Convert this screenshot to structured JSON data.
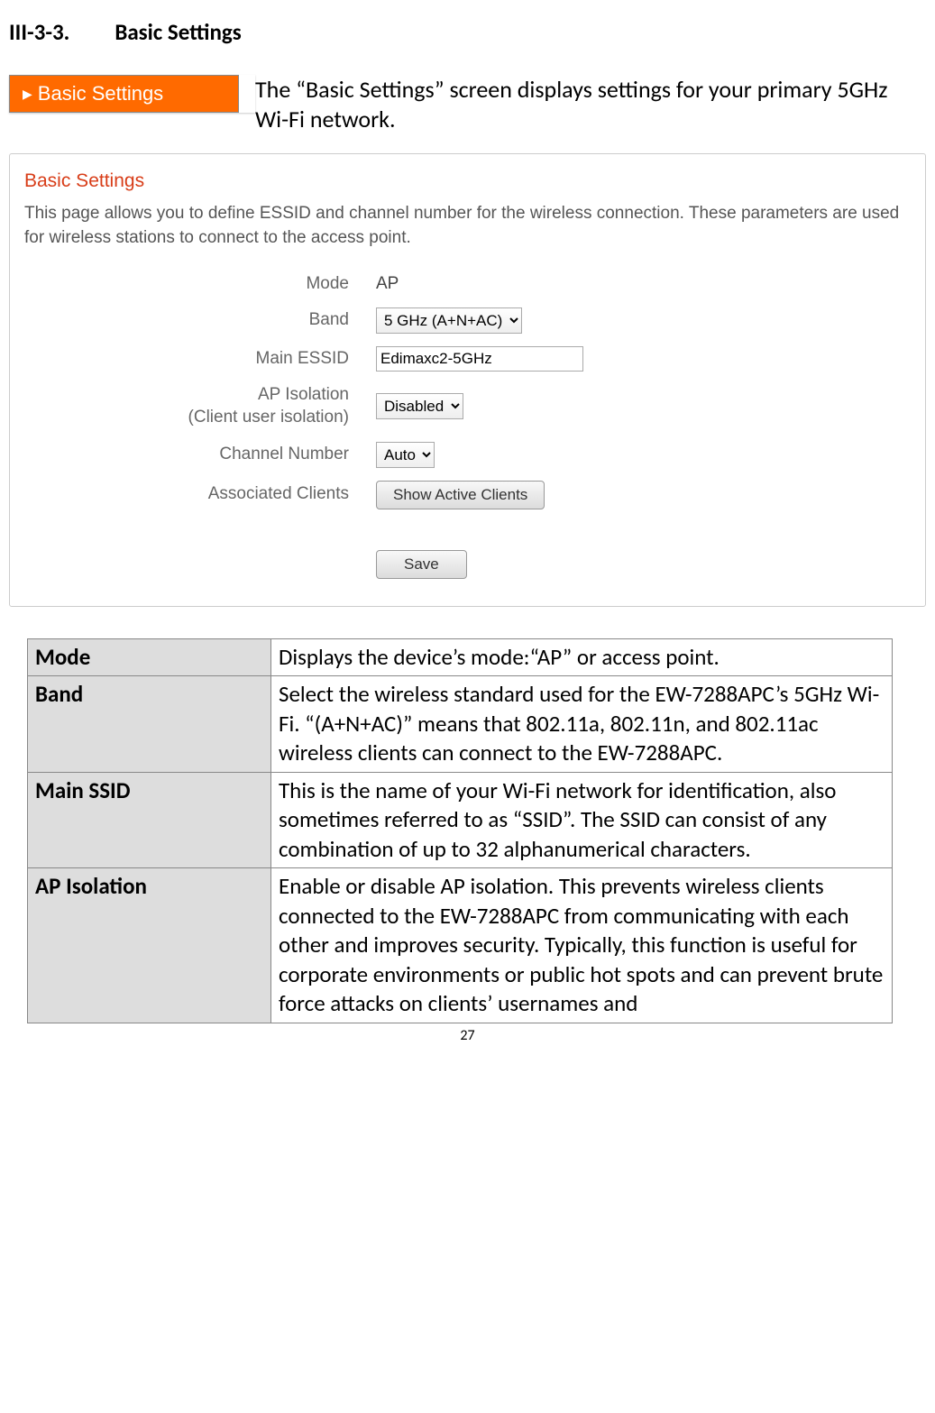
{
  "heading": {
    "number": "III-3-3.",
    "title": "Basic Settings"
  },
  "nav_chip": {
    "label": "Basic Settings"
  },
  "intro": "The “Basic Settings” screen displays settings for your primary 5GHz Wi-Fi network.",
  "panel": {
    "title": "Basic Settings",
    "description": "This page allows you to define ESSID and channel number for the wireless connection. These parameters are used for wireless stations to connect to the access point.",
    "fields": {
      "mode_label": "Mode",
      "mode_value": "AP",
      "band_label": "Band",
      "band_value": "5 GHz (A+N+AC)",
      "essid_label": "Main ESSID",
      "essid_value": "Edimaxc2-5GHz",
      "ap_isolation_label_line1": "AP Isolation",
      "ap_isolation_label_line2": "(Client user isolation)",
      "ap_isolation_value": "Disabled",
      "channel_label": "Channel Number",
      "channel_value": "Auto",
      "clients_label": "Associated Clients",
      "clients_button": "Show Active Clients",
      "save_button": "Save"
    }
  },
  "table": {
    "rows": [
      {
        "name": "Mode",
        "desc": "Displays the device’s mode:“AP” or access point."
      },
      {
        "name": "Band",
        "desc": "Select the wireless standard used for the EW-7288APC’s 5GHz Wi-Fi. “(A+N+AC)” means that 802.11a, 802.11n, and 802.11ac wireless clients can connect to the EW-7288APC."
      },
      {
        "name": "Main SSID",
        "desc": "This is the name of your Wi-Fi network for identification, also sometimes referred to as “SSID”. The SSID can consist of any combination of up to 32 alphanumerical characters."
      },
      {
        "name": "AP Isolation",
        "desc": "Enable or disable AP isolation. This prevents wireless clients connected to the EW-7288APC from communicating with each other and improves security. Typically, this function is useful for corporate environments or public hot spots and can prevent brute force attacks on clients’ usernames and"
      }
    ]
  },
  "page_number": "27"
}
